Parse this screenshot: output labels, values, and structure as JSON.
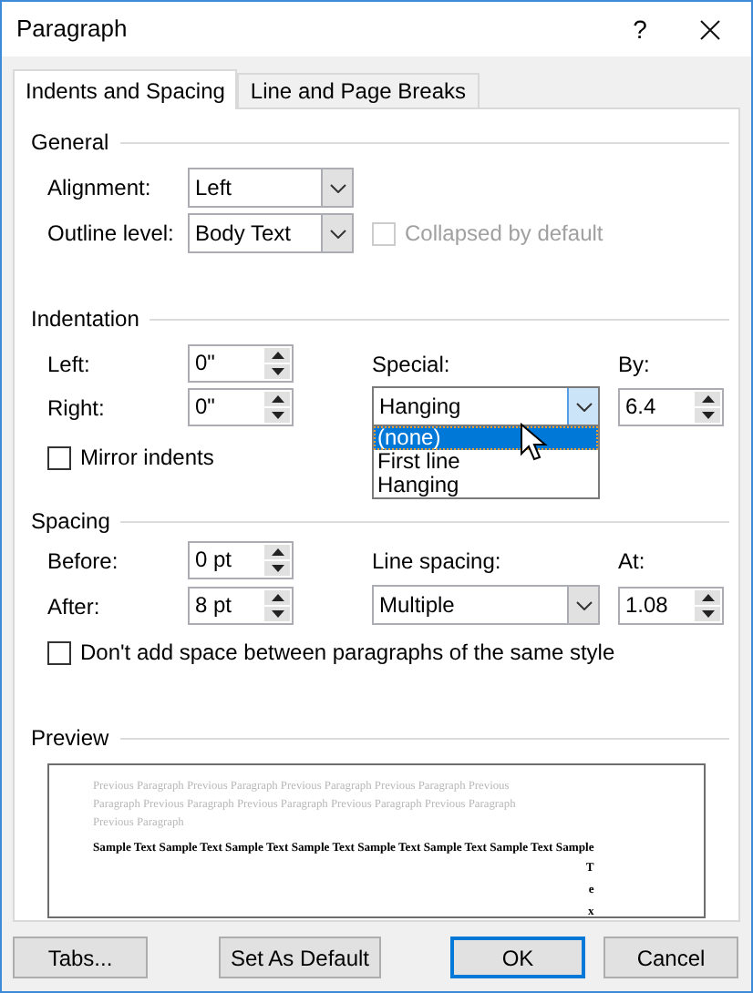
{
  "window": {
    "title": "Paragraph",
    "help": "?"
  },
  "tabs": [
    {
      "label": "Indents and Spacing",
      "selected": true
    },
    {
      "label": "Line and Page Breaks",
      "selected": false
    }
  ],
  "general": {
    "heading": "General",
    "alignment": {
      "label": "Alignment:",
      "value": "Left"
    },
    "outline_level": {
      "label": "Outline level:",
      "value": "Body Text"
    },
    "collapsed": {
      "label": "Collapsed by default",
      "checked": false,
      "disabled": true
    }
  },
  "indentation": {
    "heading": "Indentation",
    "left": {
      "label": "Left:",
      "value": "0\""
    },
    "right": {
      "label": "Right:",
      "value": "0\""
    },
    "special": {
      "label": "Special:",
      "value": "Hanging",
      "expanded": true,
      "options": [
        {
          "label": "(none)",
          "highlighted": true
        },
        {
          "label": "First line",
          "highlighted": false
        },
        {
          "label": "Hanging",
          "highlighted": false
        }
      ]
    },
    "by": {
      "label": "By:",
      "value": "6.4"
    },
    "mirror": {
      "label": "Mirror indents",
      "checked": false,
      "disabled": false
    }
  },
  "spacing": {
    "heading": "Spacing",
    "before": {
      "label": "Before:",
      "value": "0 pt"
    },
    "after": {
      "label": "After:",
      "value": "8 pt"
    },
    "line_spacing": {
      "label": "Line spacing:",
      "value": "Multiple",
      "expanded": false
    },
    "at": {
      "label": "At:",
      "value": "1.08"
    },
    "dont_add": {
      "label": "Don't add space between paragraphs of the same style",
      "checked": false,
      "disabled": false
    }
  },
  "preview": {
    "heading": "Preview",
    "previous_lines": [
      "Previous Paragraph Previous Paragraph Previous Paragraph Previous Paragraph Previous",
      "Paragraph Previous Paragraph Previous Paragraph Previous Paragraph Previous Paragraph",
      "Previous Paragraph"
    ],
    "sample_lines": [
      "Sample Text Sample Text Sample Text Sample Text Sample Text Sample Text Sample Text Sample"
    ],
    "overflow_letters": [
      "T",
      "e",
      "x"
    ]
  },
  "buttons": [
    {
      "label": "Tabs...",
      "default": false
    },
    {
      "label": "Set As Default",
      "default": false
    },
    {
      "label": "OK",
      "default": true
    },
    {
      "label": "Cancel",
      "default": false
    }
  ]
}
